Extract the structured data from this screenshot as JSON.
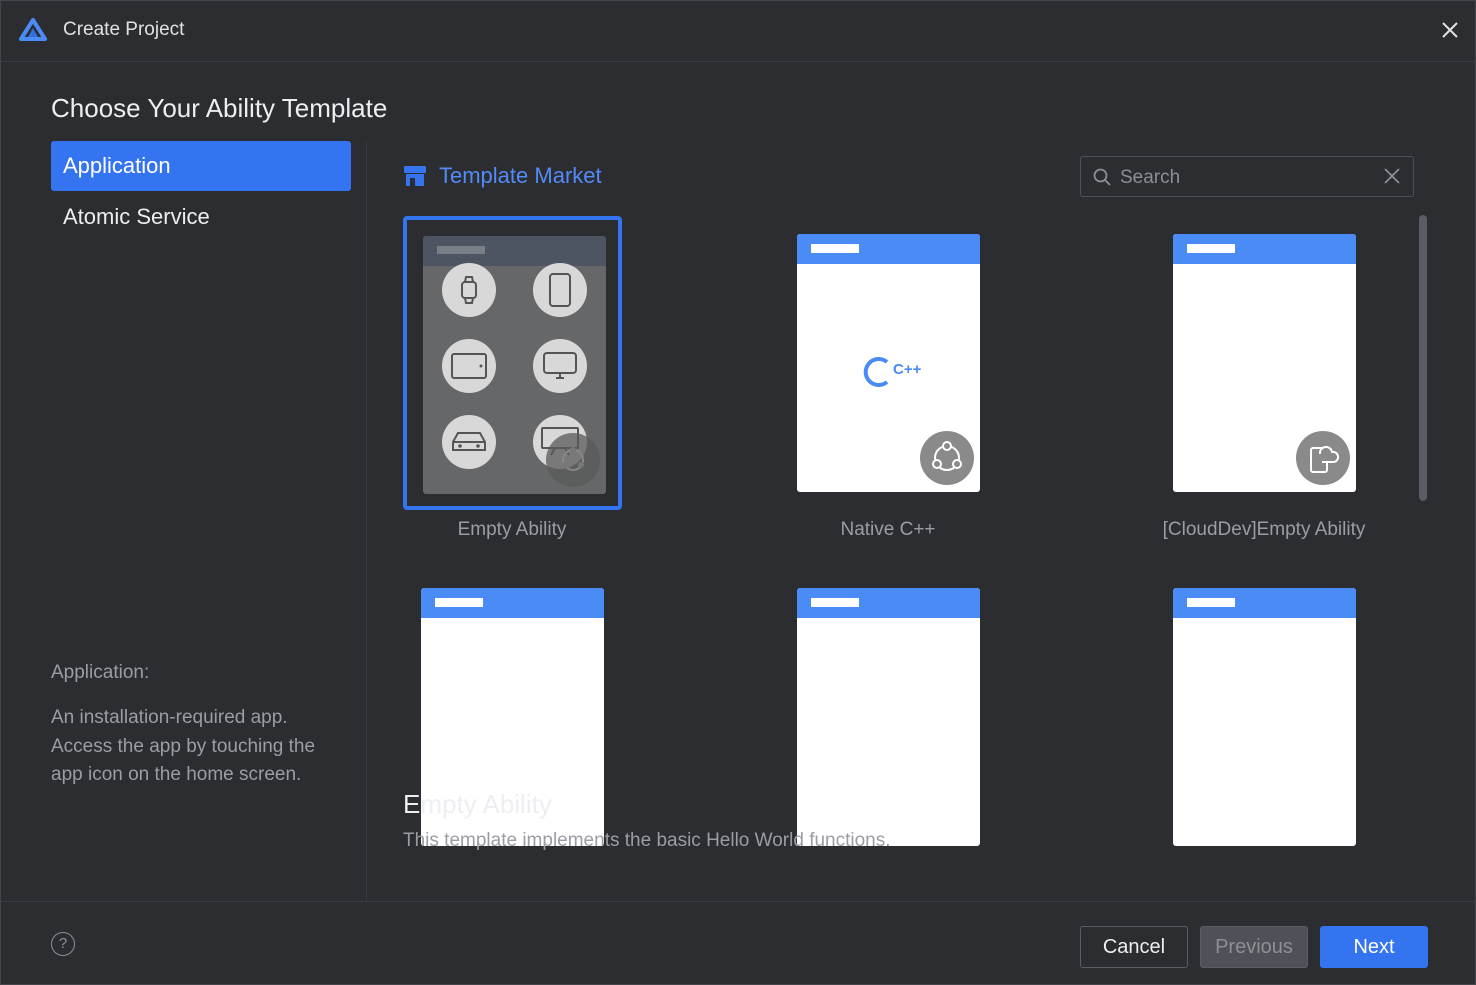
{
  "window": {
    "title": "Create Project"
  },
  "heading": "Choose Your Ability Template",
  "sidebar": {
    "items": [
      {
        "label": "Application",
        "active": true
      },
      {
        "label": "Atomic Service",
        "active": false
      }
    ],
    "description": {
      "title": "Application:",
      "body": "An installation-required app. Access the app by touching the app icon on the home screen."
    }
  },
  "market": {
    "label": "Template Market",
    "icon": "store-icon"
  },
  "search": {
    "placeholder": "Search",
    "value": ""
  },
  "templates": [
    {
      "label": "Empty Ability",
      "selected": true
    },
    {
      "label": "Native C++",
      "selected": false,
      "thumb_text": "C++"
    },
    {
      "label": "[CloudDev]Empty Ability",
      "selected": false
    },
    {
      "label": "",
      "selected": false
    },
    {
      "label": "",
      "selected": false
    },
    {
      "label": "",
      "selected": false
    }
  ],
  "detail": {
    "title": "Empty Ability",
    "description": "This template implements the basic Hello World functions."
  },
  "footer": {
    "help": "?",
    "cancel": "Cancel",
    "previous": "Previous",
    "next": "Next"
  },
  "colors": {
    "accent": "#3574f0",
    "link": "#548af7",
    "background": "#2b2d30"
  }
}
